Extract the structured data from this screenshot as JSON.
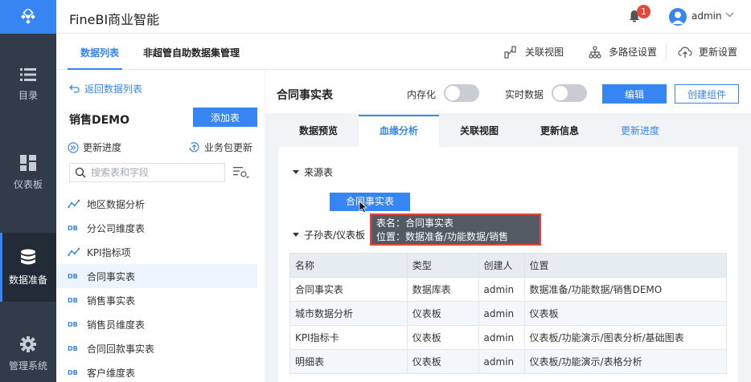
{
  "app": {
    "title": "FineBI商业智能",
    "notification_count": "1",
    "user": "admin"
  },
  "nav": [
    {
      "label": "目录",
      "icon": "list-icon"
    },
    {
      "label": "仪表板",
      "icon": "dashboard-icon"
    },
    {
      "label": "数据准备",
      "icon": "database-icon",
      "active": true
    },
    {
      "label": "管理系统",
      "icon": "gear-icon"
    }
  ],
  "top_tabs": {
    "data_list": "数据列表",
    "self_service": "非超管自助数据集管理"
  },
  "toolbar": {
    "relation_view": "关联视图",
    "multipath": "多路径设置",
    "update_settings": "更新设置"
  },
  "left": {
    "back": "返回数据列表",
    "package_title": "销售DEMO",
    "add_table": "添加表",
    "update_progress": "更新进度",
    "package_update": "业务包更新",
    "search_placeholder": "搜索表和字段",
    "tables": [
      {
        "name": "地区数据分析",
        "type": "analysis"
      },
      {
        "name": "分公司维度表",
        "type": "DB"
      },
      {
        "name": "KPI指标项",
        "type": "analysis"
      },
      {
        "name": "合同事实表",
        "type": "DB",
        "active": true
      },
      {
        "name": "销售事实表",
        "type": "DB"
      },
      {
        "name": "销售员维度表",
        "type": "DB"
      },
      {
        "name": "合同回款事实表",
        "type": "DB"
      },
      {
        "name": "客户维度表",
        "type": "DB"
      }
    ]
  },
  "main": {
    "title": "合同事实表",
    "in_memory": "内存化",
    "realtime": "实时数据",
    "edit": "编辑",
    "create_component": "创建组件",
    "tabs": {
      "preview": "数据预览",
      "lineage": "血缘分析",
      "relation": "关联视图",
      "update_info": "更新信息",
      "update_progress": "更新进度"
    },
    "source_section": "来源表",
    "source_table": "合同事实表",
    "tooltip": {
      "line1": "表名：合同事实表",
      "line2": "位置：数据准备/功能数据/销售DEMO"
    },
    "child_section": "子孙表/仪表板",
    "table": {
      "headers": [
        "名称",
        "类型",
        "创建人",
        "位置"
      ],
      "rows": [
        [
          "合同事实表",
          "数据库表",
          "admin",
          "数据准备/功能数据/销售DEMO"
        ],
        [
          "城市数据分析",
          "仪表板",
          "admin",
          "仪表板"
        ],
        [
          "KPI指标卡",
          "仪表板",
          "admin",
          "仪表板/功能演示/图表分析/基础图表"
        ],
        [
          "明细表",
          "仪表板",
          "admin",
          "仪表板/功能演示/表格分析"
        ]
      ]
    }
  },
  "colors": {
    "accent": "#3685f2",
    "rail": "#313b4a",
    "tooltip_border": "#e8453c"
  }
}
